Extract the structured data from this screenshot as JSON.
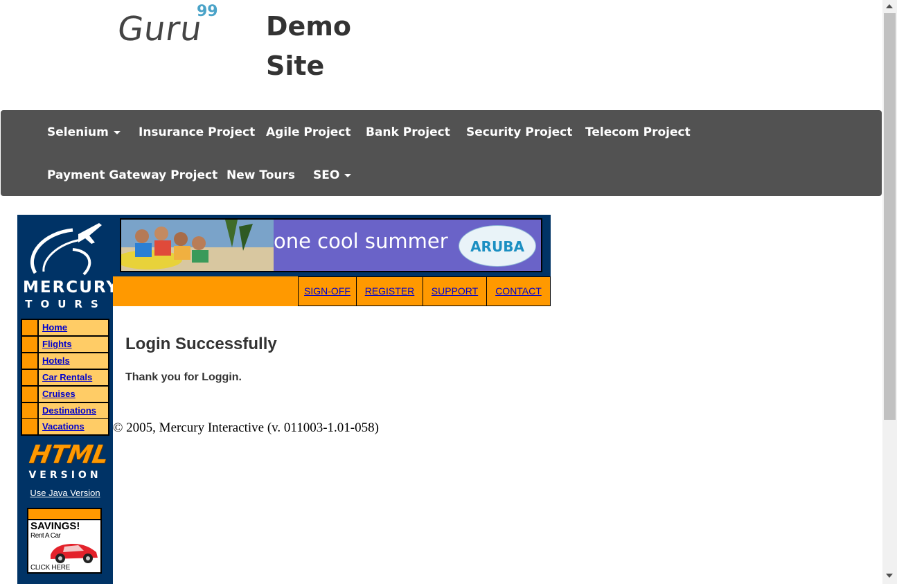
{
  "header": {
    "logo_word": "Guru",
    "logo_sup": "99",
    "site_title_line1": "Demo",
    "site_title_line2": "Site"
  },
  "nav": {
    "items": [
      {
        "label": "Selenium",
        "dropdown": true
      },
      {
        "label": "Insurance Project",
        "dropdown": false
      },
      {
        "label": "Agile Project",
        "dropdown": false
      },
      {
        "label": "Bank Project",
        "dropdown": false
      },
      {
        "label": "Security Project",
        "dropdown": false
      },
      {
        "label": "Telecom Project",
        "dropdown": false
      },
      {
        "label": "Payment Gateway Project",
        "dropdown": false
      },
      {
        "label": "New Tours",
        "dropdown": false
      },
      {
        "label": "SEO",
        "dropdown": true
      }
    ]
  },
  "mercury": {
    "logo_line1": "MERCURY",
    "logo_line2": "TOURS",
    "side_menu": [
      "Home",
      "Flights",
      "Hotels",
      "Car Rentals",
      "Cruises",
      "Destinations",
      "Vacations"
    ],
    "html_version_line1": "HTML",
    "html_version_line2": "VERSION",
    "java_link": "Use Java Version",
    "ad": {
      "headline": "SAVINGS!",
      "subline": "Rent A Car",
      "cta": "CLICK HERE"
    },
    "banner_text": "one cool summer",
    "banner_brand": "ARUBA",
    "top_links": [
      "SIGN-OFF",
      "REGISTER",
      "SUPPORT",
      "CONTACT"
    ],
    "heading": "Login Successfully",
    "message": "Thank you for Loggin.",
    "copyright": "© 2005, Mercury Interactive (v. 011003-1.01-058)"
  },
  "colors": {
    "navbar": "#525252",
    "mercury_blue": "#003366",
    "orange": "#ff9900",
    "side_cell": "#ffcc66",
    "link": "#0000cc",
    "banner": "#6a63c8"
  }
}
